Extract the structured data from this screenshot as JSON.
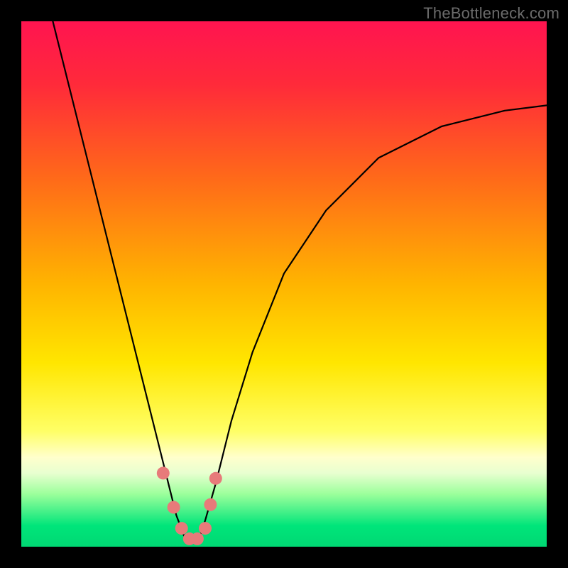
{
  "watermark": "TheBottleneck.com",
  "chart_data": {
    "type": "line",
    "title": "",
    "xlabel": "",
    "ylabel": "",
    "xlim": [
      0,
      100
    ],
    "ylim": [
      0,
      100
    ],
    "gradient_stops": [
      {
        "offset": 0.0,
        "color": "#ff1450"
      },
      {
        "offset": 0.12,
        "color": "#ff2a3a"
      },
      {
        "offset": 0.3,
        "color": "#ff6a19"
      },
      {
        "offset": 0.5,
        "color": "#ffb400"
      },
      {
        "offset": 0.65,
        "color": "#ffe600"
      },
      {
        "offset": 0.78,
        "color": "#ffff66"
      },
      {
        "offset": 0.83,
        "color": "#ffffcc"
      },
      {
        "offset": 0.86,
        "color": "#e8ffd0"
      },
      {
        "offset": 0.9,
        "color": "#9bff9b"
      },
      {
        "offset": 0.96,
        "color": "#00e57a"
      },
      {
        "offset": 1.0,
        "color": "#00d873"
      }
    ],
    "series": [
      {
        "name": "bottleneck-curve",
        "x": [
          6.0,
          9.0,
          12.0,
          15.0,
          18.0,
          20.0,
          22.0,
          24.0,
          26.0,
          28.0,
          29.5,
          31.0,
          32.5,
          34.0,
          35.0,
          37.0,
          40.0,
          44.0,
          50.0,
          58.0,
          68.0,
          80.0,
          92.0,
          100.0
        ],
        "values": [
          100.0,
          88.0,
          76.0,
          64.0,
          52.0,
          44.0,
          36.0,
          28.0,
          20.0,
          12.0,
          6.0,
          2.0,
          1.0,
          2.0,
          5.0,
          12.0,
          24.0,
          37.0,
          52.0,
          64.0,
          74.0,
          80.0,
          83.0,
          84.0
        ]
      }
    ],
    "markers": {
      "name": "highlight-points",
      "color": "#e77a7a",
      "radius": 9,
      "x": [
        27.0,
        29.0,
        30.5,
        32.0,
        33.5,
        35.0,
        36.0,
        37.0
      ],
      "values": [
        14.0,
        7.5,
        3.5,
        1.5,
        1.5,
        3.5,
        8.0,
        13.0
      ]
    }
  }
}
